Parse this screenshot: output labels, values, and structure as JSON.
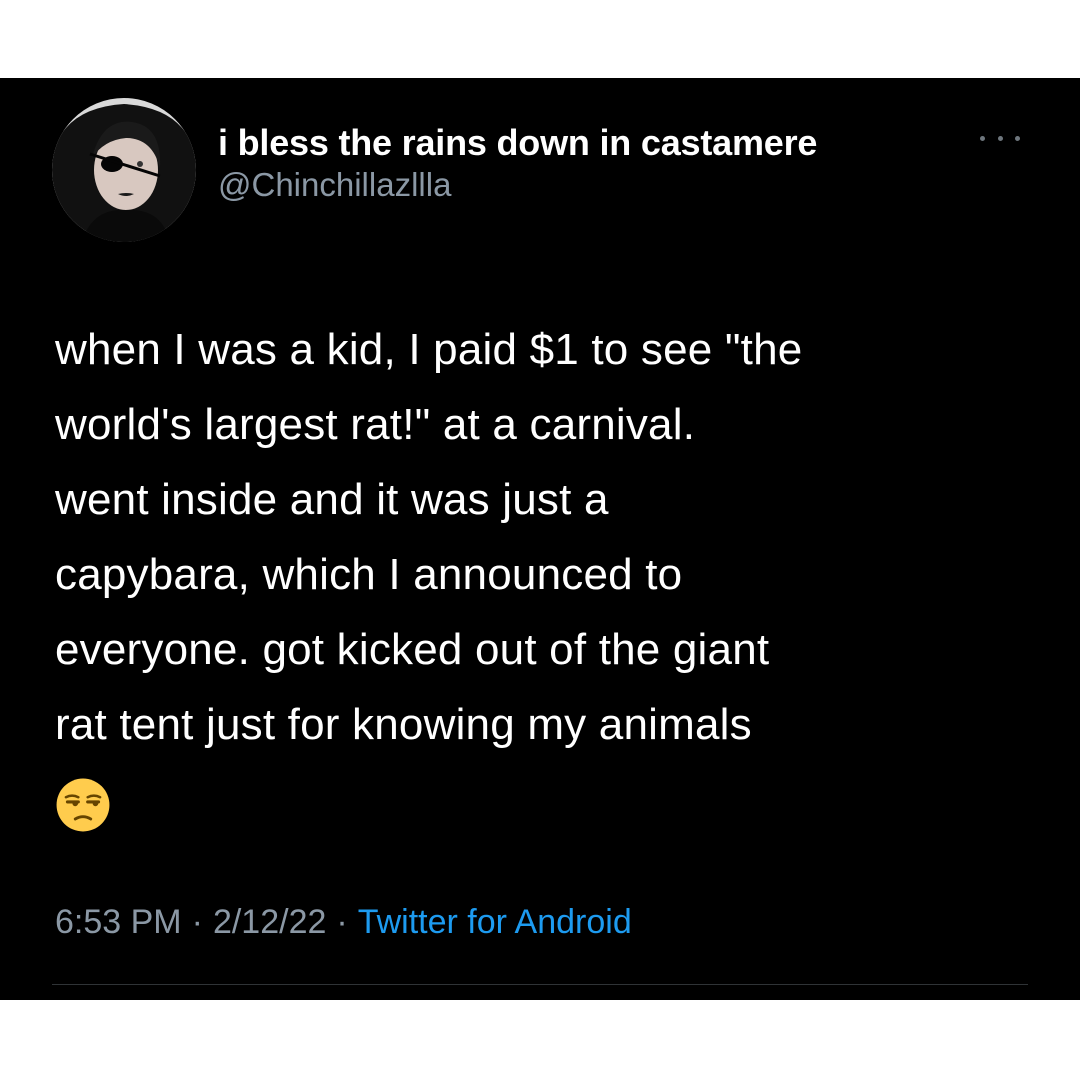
{
  "tweet": {
    "author": {
      "display_name": "i bless the rains down in castamere",
      "handle": "@Chinchillazllla",
      "avatar_icon": "profile-photo"
    },
    "more_icon": "more-horizontal-icon",
    "text_lines": [
      "when I was a kid, I paid $1 to see \"the",
      "world's largest rat!\" at a carnival.",
      "went inside and it was just a",
      "capybara, which I announced to",
      "everyone. got kicked out of the giant",
      "rat tent just for knowing my animals"
    ],
    "emoji": "unamused-face-emoji",
    "meta": {
      "time": "6:53 PM",
      "separator": "·",
      "date": "2/12/22",
      "source": "Twitter for Android"
    }
  },
  "colors": {
    "background": "#000000",
    "frame": "#ffffff",
    "text": "#ffffff",
    "secondary": "#8b98a5",
    "link": "#1d9bf0",
    "divider": "#2f3336"
  }
}
